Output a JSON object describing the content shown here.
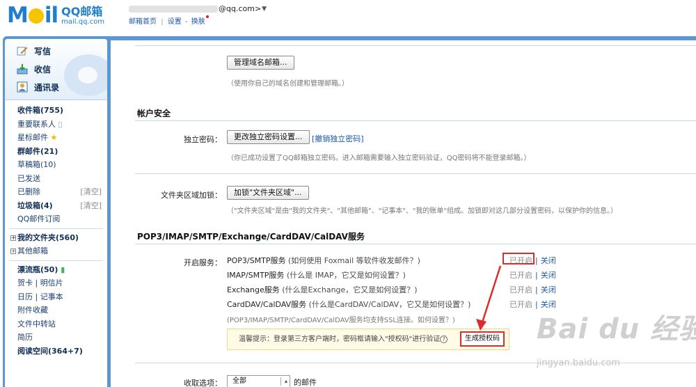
{
  "header": {
    "logo_mail": "MOil",
    "logo_title": "QQ邮箱",
    "logo_domain": "mail.qq.com",
    "user_email_suffix": "@qq.com>",
    "user_caret": "▼",
    "menu": {
      "home": "邮箱首页",
      "sep": "|",
      "settings": "设置",
      "dash": "-",
      "skin": "换肤"
    }
  },
  "sidebar": {
    "quick": [
      {
        "label": "写信",
        "icon": "pencil-icon"
      },
      {
        "label": "收信",
        "icon": "inbox-icon"
      },
      {
        "label": "通讯录",
        "icon": "contacts-icon"
      }
    ],
    "folders_a": [
      {
        "label": "收件箱(755)",
        "bold": true
      },
      {
        "label": "重要联系人",
        "bold": false
      },
      {
        "label": "星标邮件",
        "bold": false
      },
      {
        "label": "群邮件(21)",
        "bold": true
      },
      {
        "label": "草稿箱(10)",
        "bold": false
      },
      {
        "label": "已发送",
        "bold": false
      },
      {
        "label": "已删除",
        "bold": false,
        "clear": "[清空]"
      },
      {
        "label": "垃圾箱(4)",
        "bold": true,
        "clear": "[清空]"
      },
      {
        "label": "QQ邮件订阅",
        "bold": false
      }
    ],
    "folders_b": [
      {
        "label": "我的文件夹(560)",
        "bold": true
      },
      {
        "label": "其他邮箱",
        "bold": false
      }
    ],
    "folders_c": [
      {
        "label": "漂流瓶(50)",
        "bold": true
      },
      {
        "label": "贺卡 | 明信片",
        "bold": false
      },
      {
        "label": "日历 | 记事本",
        "bold": false
      },
      {
        "label": "附件收藏",
        "bold": false
      },
      {
        "label": "文件中转站",
        "bold": false
      },
      {
        "label": "简历",
        "bold": false
      },
      {
        "label": "阅读空间(364+7)",
        "bold": true
      }
    ]
  },
  "main": {
    "domain_btn": "管理域名邮箱...",
    "domain_hint": "（使用你自己的域名创建和管理邮箱。）",
    "account_security_title": "帐户安全",
    "pwd_label": "独立密码：",
    "pwd_btn": "更改独立密码设置...",
    "pwd_cancel": "[撤销独立密码]",
    "pwd_hint": "（你已成功设置了QQ邮箱独立密码。进入邮箱需要输入独立密码验证，QQ密码将不能登录邮箱。）",
    "lock_label": "文件夹区域加锁：",
    "lock_btn": "加锁\"文件夹区域\"...",
    "lock_hint": "（\"文件夹区域\"是由\"我的文件夹\"、\"其他邮箱\"、\"记事本\"、\"我的账单\"组成。加锁即对这几部分设置密码，以保护你的信息。）",
    "pop_title": "POP3/IMAP/SMTP/Exchange/CardDAV/CalDAV服务",
    "enable_label": "开启服务：",
    "services": [
      {
        "name": "POP3/SMTP服务",
        "note": "(如何使用 Foxmail 等软件收发邮件？)",
        "state": "已开启",
        "bar": "|",
        "action": "关闭"
      },
      {
        "name": "IMAP/SMTP服务",
        "note": "(什么是 IMAP，它又是如何设置？)",
        "state": "已开启",
        "bar": "|",
        "action": "关闭"
      },
      {
        "name": "Exchange服务",
        "note": "(什么是Exchange，它又是如何设置？)",
        "state": "已开启",
        "bar": "|",
        "action": "关闭"
      },
      {
        "name": "CardDAV/CalDAV服务",
        "note": "(什么是CardDAV/CalDAV，它又是如何设置？)",
        "state": "已开启",
        "bar": "|",
        "action": "关闭"
      }
    ],
    "ssl_hint": "(POP3/IMAP/SMTP/CardDAV/CalDAV服务均支持SSL连接。如何设置？)",
    "warn_text": "温馨提示：登录第三方客户端时，密码框请输入\"授权码\"进行验证",
    "warn_qm": "?",
    "gen_btn": "生成授权码",
    "receive_label": "收取选项：",
    "receive_select": "全部",
    "receive_suffix": "的邮件"
  },
  "watermark": {
    "brand": "Bai du 经验",
    "url": "jingyan.baidu.com"
  },
  "colors": {
    "frame_blue": "#5b97d3",
    "link_blue": "#1b58a8",
    "highlight_red": "#e02a2a",
    "warn_bg": "#fffbe7"
  }
}
